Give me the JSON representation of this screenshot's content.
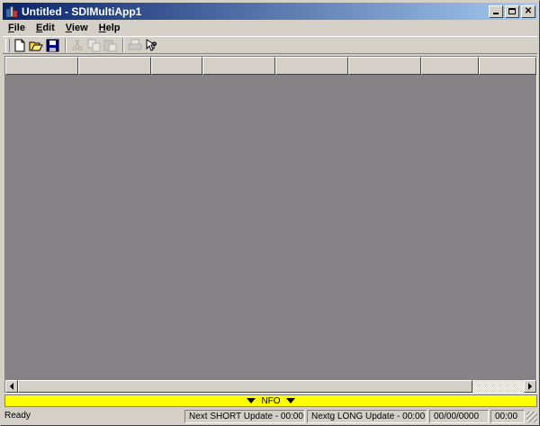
{
  "window": {
    "title": "Untitled - SDIMultiApp1"
  },
  "menu": {
    "items": [
      {
        "label": "File",
        "accel": "F"
      },
      {
        "label": "Edit",
        "accel": "E"
      },
      {
        "label": "View",
        "accel": "V"
      },
      {
        "label": "Help",
        "accel": "H"
      }
    ]
  },
  "toolbar": {
    "buttons": [
      {
        "name": "new-icon",
        "enabled": true
      },
      {
        "name": "open-icon",
        "enabled": true
      },
      {
        "name": "save-icon",
        "enabled": true
      },
      {
        "name": "cut-icon",
        "enabled": false
      },
      {
        "name": "copy-icon",
        "enabled": false
      },
      {
        "name": "paste-icon",
        "enabled": false
      },
      {
        "name": "print-icon",
        "enabled": false
      },
      {
        "name": "help-icon",
        "enabled": true
      }
    ]
  },
  "grid": {
    "header_count": 8,
    "content_color": "#858386"
  },
  "info_bar": {
    "label": "NFO",
    "color": "#ffff00"
  },
  "status": {
    "ready": "Ready",
    "short_update": "Next SHORT Update - 00:00",
    "long_update": "Nextg LONG Update - 00:00",
    "date": "00/00/0000",
    "time": "00:00"
  }
}
